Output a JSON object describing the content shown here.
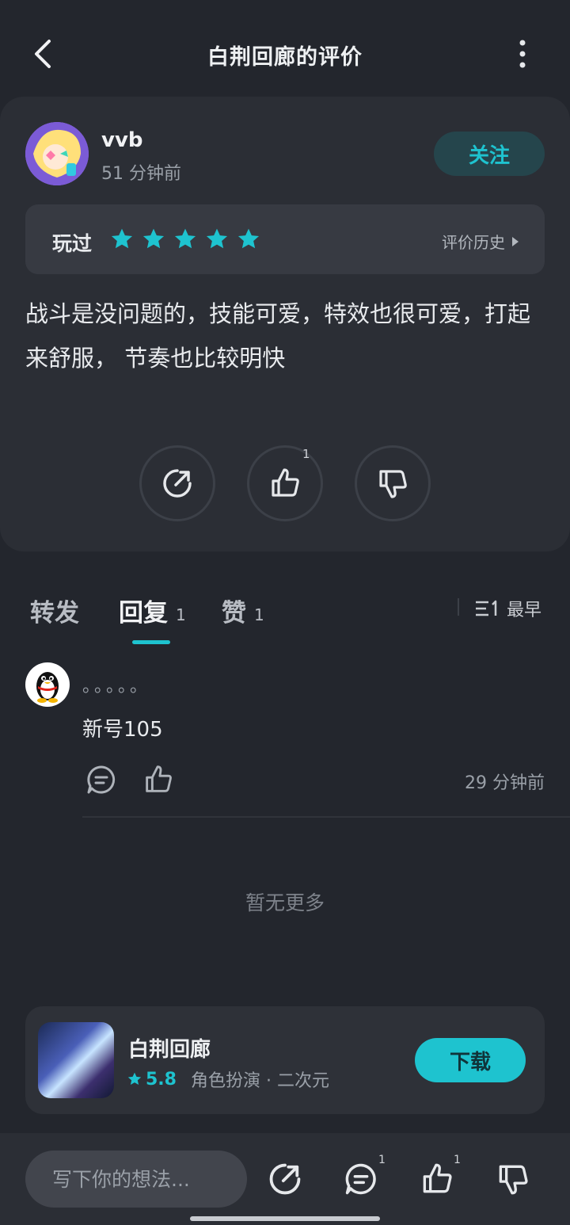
{
  "header": {
    "title": "白荆回廊的评价"
  },
  "author": {
    "name": "vvb",
    "time": "51 分钟前",
    "follow_label": "关注"
  },
  "rating": {
    "played_label": "玩过",
    "stars": 5,
    "history_label": "评价历史"
  },
  "review": {
    "text": "战斗是没问题的，技能可爱，特效也很可爱，打起来舒服， 节奏也比较明快"
  },
  "actions": {
    "like_count": "1"
  },
  "tabs": [
    {
      "label": "转发",
      "count": ""
    },
    {
      "label": "回复",
      "count": "1"
    },
    {
      "label": "赞",
      "count": "1"
    }
  ],
  "sort": {
    "label": "最早"
  },
  "reply": {
    "name": "。。。。。",
    "text": "新号105",
    "time": "29 分钟前"
  },
  "no_more": "暂无更多",
  "game": {
    "name": "白荆回廊",
    "score": "5.8",
    "tags": "角色扮演 · 二次元",
    "download_label": "下载"
  },
  "bottom_bar": {
    "placeholder": "写下你的想法...",
    "comment_count": "1",
    "like_count": "1"
  },
  "colors": {
    "accent": "#1ec3cf",
    "background": "#23262d",
    "card": "#2b2e35"
  }
}
